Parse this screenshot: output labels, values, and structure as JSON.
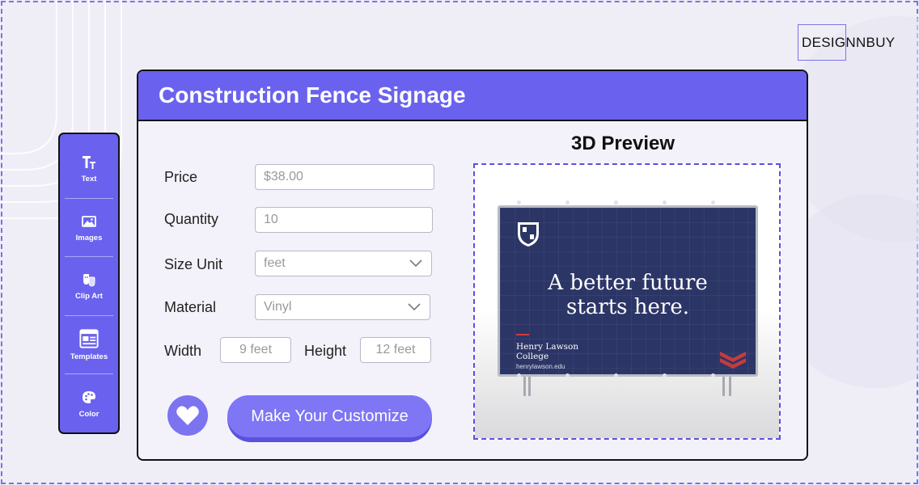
{
  "brand": {
    "name": "DESIGNNBUY"
  },
  "toolbar": {
    "items": [
      {
        "label": "Text",
        "icon": "text-icon"
      },
      {
        "label": "Images",
        "icon": "image-icon"
      },
      {
        "label": "Clip Art",
        "icon": "clip-art-icon"
      },
      {
        "label": "Templates",
        "icon": "templates-icon"
      },
      {
        "label": "Color",
        "icon": "palette-icon"
      }
    ]
  },
  "product": {
    "title": "Construction Fence Signage"
  },
  "form": {
    "price_label": "Price",
    "price_placeholder": "$38.00",
    "quantity_label": "Quantity",
    "quantity_placeholder": "10",
    "size_unit_label": "Size Unit",
    "size_unit_value": "feet",
    "material_label": "Material",
    "material_value": "Vinyl",
    "width_label": "Width",
    "width_placeholder": "9 feet",
    "height_label": "Height",
    "height_placeholder": "12 feet"
  },
  "actions": {
    "favorite_icon": "heart-icon",
    "customize_label": "Make Your Customize"
  },
  "preview": {
    "title": "3D Preview",
    "banner": {
      "headline_line1": "A better future",
      "headline_line2": "starts here.",
      "college_line1": "Henry Lawson",
      "college_line2": "College",
      "url": "henrylawson.edu"
    }
  },
  "colors": {
    "accent": "#6a62ee",
    "button": "#7e76f4",
    "banner": "#2b3566"
  }
}
